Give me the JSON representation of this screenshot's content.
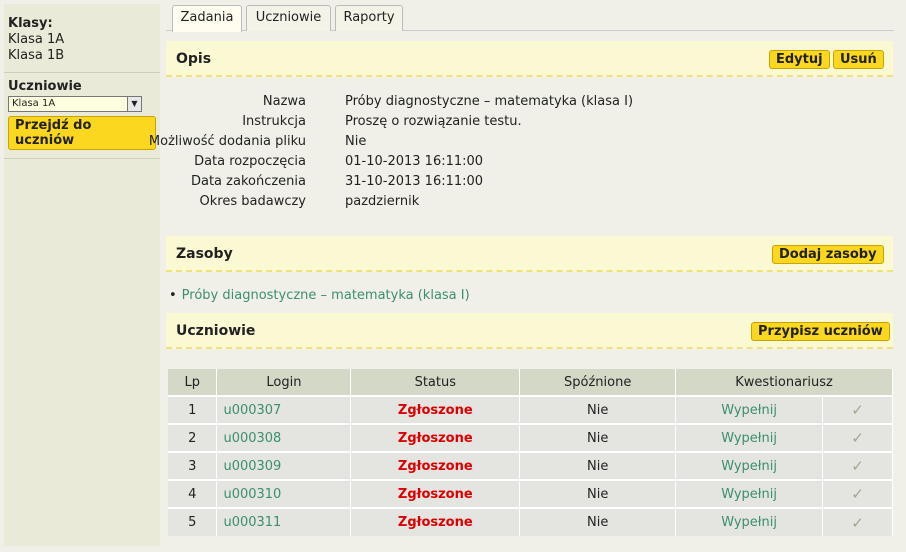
{
  "sidebar": {
    "classes_header": "Klasy:",
    "classes": [
      "Klasa 1A",
      "Klasa 1B"
    ],
    "students_header": "Uczniowie",
    "select_value": "Klasa 1A",
    "go_button": "Przejdź do uczniów"
  },
  "tabs": [
    "Zadania",
    "Uczniowie",
    "Raporty"
  ],
  "opis": {
    "title": "Opis",
    "edit_button": "Edytuj",
    "delete_button": "Usuń",
    "fields": [
      {
        "label": "Nazwa",
        "value": "Próby diagnostyczne – matematyka (klasa I)"
      },
      {
        "label": "Instrukcja",
        "value": "Proszę o rozwiązanie testu."
      },
      {
        "label": "Możliwość dodania pliku",
        "value": "Nie"
      },
      {
        "label": "Data rozpoczęcia",
        "value": "01-10-2013 16:11:00"
      },
      {
        "label": "Data zakończenia",
        "value": "31-10-2013 16:11:00"
      },
      {
        "label": "Okres badawczy",
        "value": "pazdziernik"
      }
    ]
  },
  "zasoby": {
    "title": "Zasoby",
    "add_button": "Dodaj zasoby",
    "items": [
      "Próby diagnostyczne – matematyka (klasa I)"
    ]
  },
  "uczniowie": {
    "title": "Uczniowie",
    "assign_button": "Przypisz uczniów",
    "columns": [
      "Lp",
      "Login",
      "Status",
      "Spóźnione",
      "Kwestionariusz"
    ],
    "rows": [
      {
        "lp": "1",
        "login": "u000307",
        "status": "Zgłoszone",
        "late": "Nie",
        "kw": "Wypełnij"
      },
      {
        "lp": "2",
        "login": "u000308",
        "status": "Zgłoszone",
        "late": "Nie",
        "kw": "Wypełnij"
      },
      {
        "lp": "3",
        "login": "u000309",
        "status": "Zgłoszone",
        "late": "Nie",
        "kw": "Wypełnij"
      },
      {
        "lp": "4",
        "login": "u000310",
        "status": "Zgłoszone",
        "late": "Nie",
        "kw": "Wypełnij"
      },
      {
        "lp": "5",
        "login": "u000311",
        "status": "Zgłoszone",
        "late": "Nie",
        "kw": "Wypełnij"
      }
    ]
  },
  "icons": {
    "check": "checkmark-icon",
    "dropdown": "chevron-down-icon"
  }
}
